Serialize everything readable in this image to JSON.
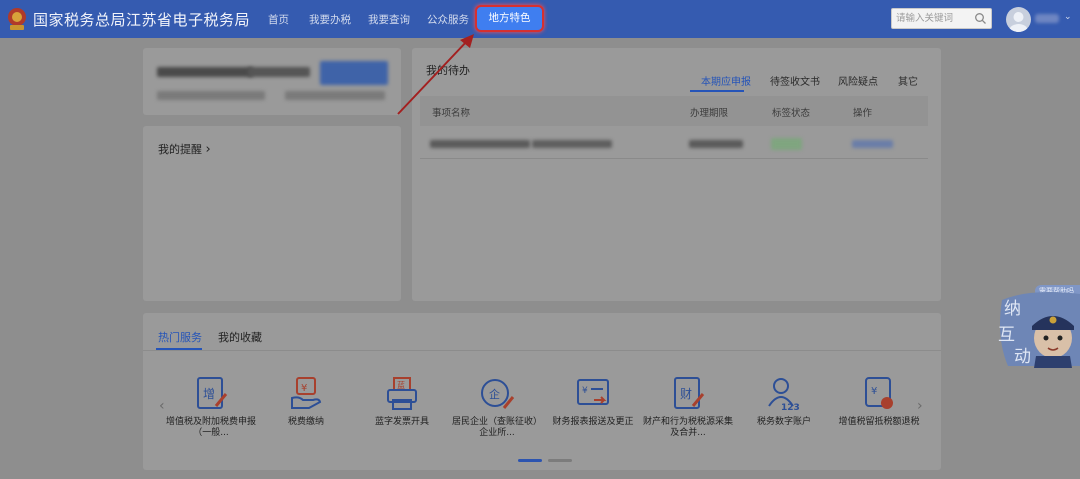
{
  "header": {
    "title": "国家税务总局江苏省电子税务局",
    "nav": [
      "首页",
      "我要办税",
      "我要查询",
      "公众服务"
    ],
    "active_nav": "地方特色",
    "search_placeholder": "请输入关键词",
    "caret": "⌄"
  },
  "reminder": {
    "title": "我的提醒",
    "chevron": "›"
  },
  "todo": {
    "title": "我的待办",
    "tabs": [
      "本期应申报",
      "待签收文书",
      "风险疑点",
      "其它"
    ],
    "active_tab": "本期应申报",
    "columns": [
      "事项名称",
      "办理期限",
      "标签状态",
      "操作"
    ]
  },
  "services": {
    "tabs": [
      "热门服务",
      "我的收藏"
    ],
    "active_tab": "热门服务",
    "items": [
      {
        "label": "增值税及附加税费申报（一般...",
        "icon": "vat-declare-icon"
      },
      {
        "label": "税费缴纳",
        "icon": "tax-payment-icon"
      },
      {
        "label": "蓝字发票开具",
        "icon": "invoice-print-icon"
      },
      {
        "label": "居民企业（查账征收）企业所...",
        "icon": "enterprise-tax-icon"
      },
      {
        "label": "财务报表报送及更正",
        "icon": "financial-report-icon"
      },
      {
        "label": "财产和行为税税源采集及合并...",
        "icon": "property-tax-icon"
      },
      {
        "label": "税务数字账户",
        "icon": "digital-account-icon"
      },
      {
        "label": "增值税留抵税额退税",
        "icon": "vat-refund-icon"
      }
    ],
    "prev": "‹",
    "next": "›"
  },
  "float": {
    "help_tag": "需要帮助吗",
    "mascot": "纳税人互动",
    "mascot_chars": [
      "纳",
      "互",
      "动"
    ]
  },
  "colors": {
    "topbar": "#355bb0",
    "accent": "#2554b8",
    "highlight_border": "#d63030",
    "annotation_arrow": "#a32020"
  }
}
